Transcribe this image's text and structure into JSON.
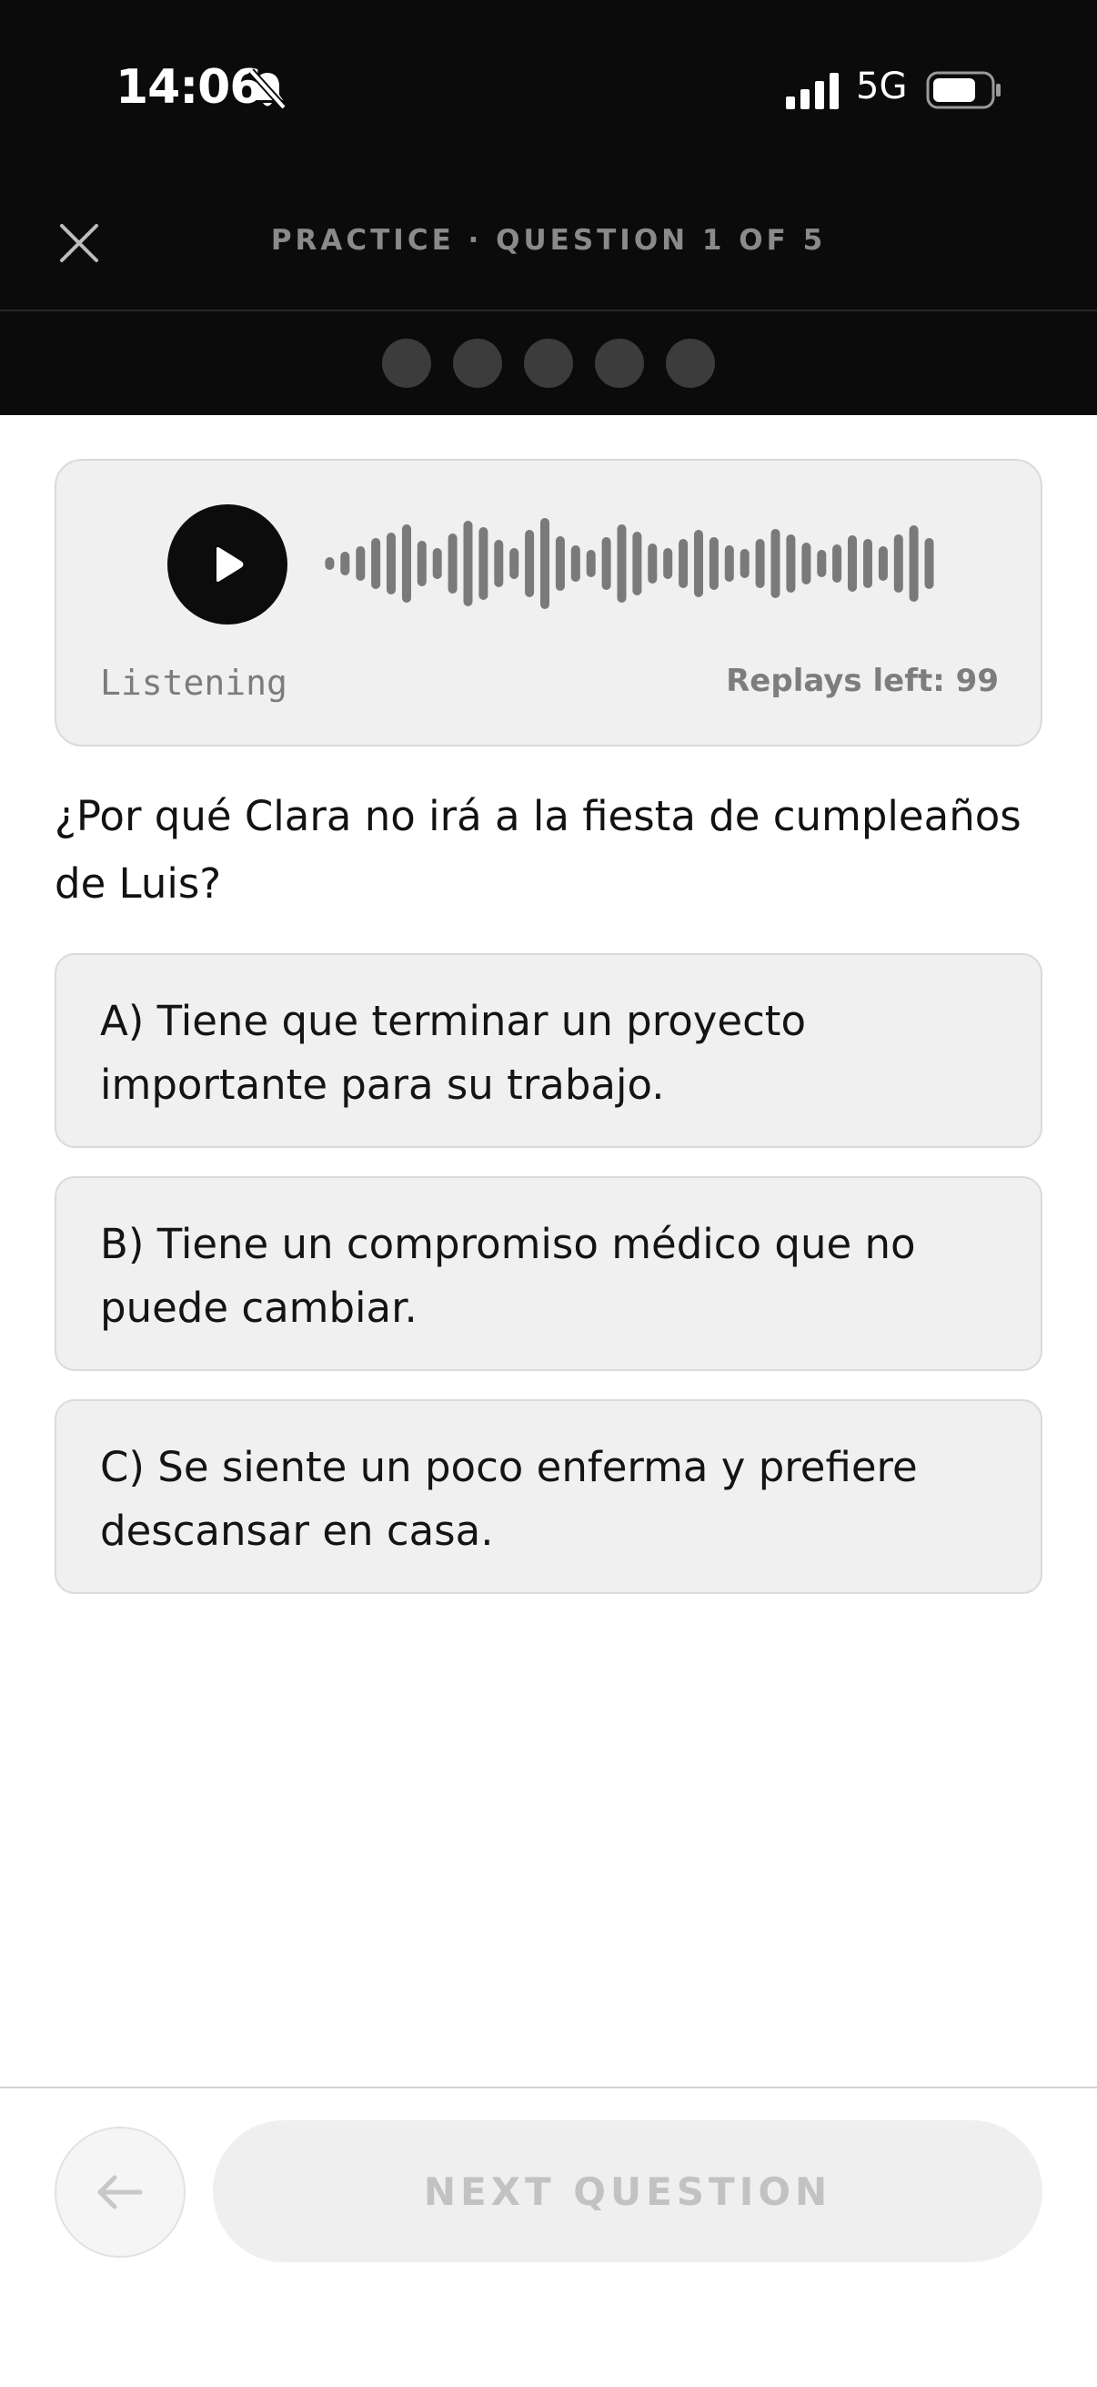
{
  "status_bar": {
    "time": "14:06",
    "network": "5G",
    "icons": [
      "bell-muted-icon",
      "signal-icon",
      "battery-icon"
    ]
  },
  "header": {
    "title": "PRACTICE · QUESTION 1 OF 5",
    "close_icon": "close-icon"
  },
  "progress": {
    "total": 5,
    "current": 1
  },
  "audio": {
    "status": "Listening",
    "replays": "Replays left: 99",
    "play_icon": "play-icon",
    "waveform_icon": "waveform-icon"
  },
  "question": {
    "text": "¿Por qué Clara no irá a la fiesta de cumpleaños de Luis?"
  },
  "options": [
    {
      "label": "A) Tiene que terminar un proyecto importante para su trabajo."
    },
    {
      "label": "B) Tiene un compromiso médico que no puede cambiar."
    },
    {
      "label": "C) Se siente un poco enferma y prefiere descansar en casa."
    }
  ],
  "footer": {
    "back_icon": "arrow-left-icon",
    "next_label": "NEXT QUESTION"
  },
  "colors": {
    "top_bar": "#0b0b0b",
    "card": "#eff0ef",
    "waveform": "#7a7a7a",
    "next_disabled": "#efefef"
  }
}
